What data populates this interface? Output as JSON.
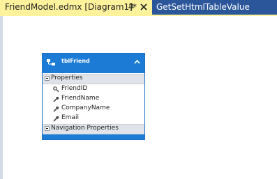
{
  "tabs": [
    {
      "label": "FriendModel.edmx [Diagram1]*",
      "active": true
    },
    {
      "label": "GetSetHtmlTableValue",
      "active": false
    }
  ],
  "entity": {
    "name": "tblFriend",
    "sections": {
      "properties": "Properties",
      "navigation": "Navigation Properties"
    },
    "properties": [
      {
        "name": "FriendID",
        "icon": "key-icon"
      },
      {
        "name": "FriendName",
        "icon": "wrench-icon"
      },
      {
        "name": "CompanyName",
        "icon": "wrench-icon"
      },
      {
        "name": "Email",
        "icon": "wrench-icon"
      }
    ]
  },
  "colors": {
    "tab_strip": "#2b579a",
    "active_tab": "#fff29d",
    "entity_header": "#1c7cd5",
    "section_header": "#e0e4ea"
  },
  "icons": {
    "pin": "pin-icon",
    "close": "close-icon",
    "entity": "entity-icon",
    "collapse": "chevron-up-icon",
    "expander": "collapse-expander-icon"
  }
}
